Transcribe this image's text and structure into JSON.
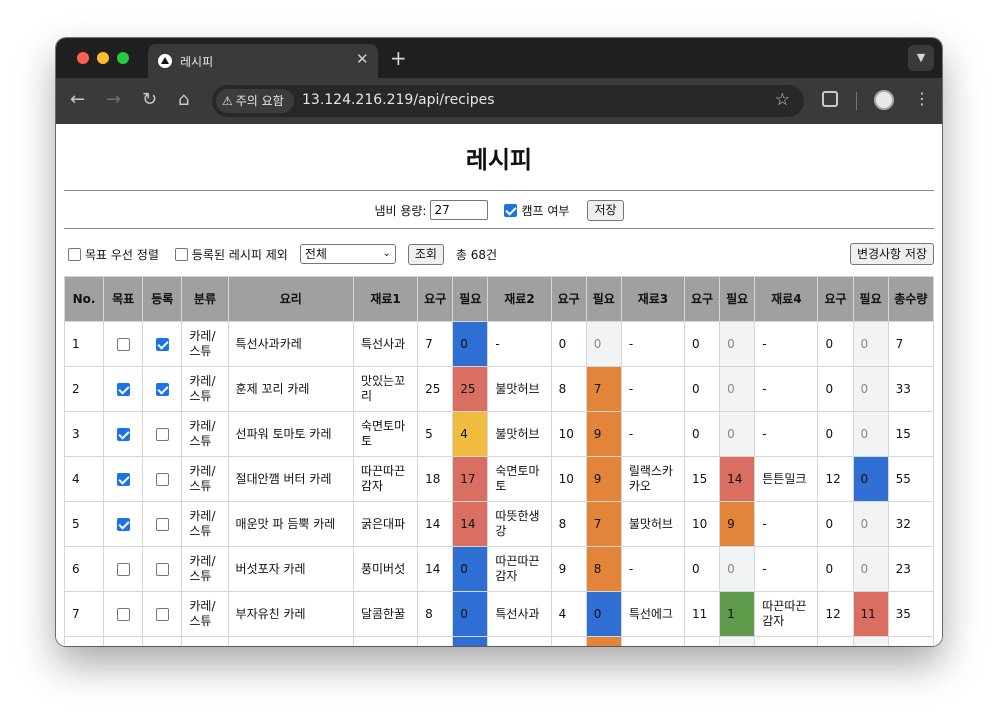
{
  "browser": {
    "tab_title": "레시피",
    "new_tab_label": "+",
    "security_chip": "주의 요함",
    "url": "13.124.216.219/api/recipes"
  },
  "page": {
    "title": "레시피",
    "settings": {
      "pot_label": "냄비 용량:",
      "pot_value": "27",
      "camp_label": "캠프 여부",
      "camp_checked": true,
      "save_label": "저장"
    },
    "filters": {
      "goal_sort_label": "목표 우선 정렬",
      "exclude_registered_label": "등록된 레시피 제외",
      "category_selected": "전체",
      "search_label": "조회",
      "total_count": "총 68건",
      "save_changes_label": "변경사항 저장"
    },
    "table": {
      "headers": [
        "No.",
        "목표",
        "등록",
        "분류",
        "요리",
        "재료1",
        "요구",
        "필요",
        "재료2",
        "요구",
        "필요",
        "재료3",
        "요구",
        "필요",
        "재료4",
        "요구",
        "필요",
        "총수량"
      ],
      "rows": [
        {
          "no": "1",
          "goal": false,
          "reg": true,
          "cat": "카레/스튜",
          "dish": "특선사과카레",
          "i1": "특선사과",
          "r1": "7",
          "n1": "0",
          "l1": "blue",
          "i2": "-",
          "r2": "0",
          "n2": "0",
          "l2": "none",
          "i3": "-",
          "r3": "0",
          "n3": "0",
          "l3": "none",
          "i4": "-",
          "r4": "0",
          "n4": "0",
          "l4": "none",
          "total": "7"
        },
        {
          "no": "2",
          "goal": true,
          "reg": true,
          "cat": "카레/스튜",
          "dish": "훈제 꼬리 카레",
          "i1": "맛있는꼬리",
          "r1": "25",
          "n1": "25",
          "l1": "red",
          "i2": "불맛허브",
          "r2": "8",
          "n2": "7",
          "l2": "orange",
          "i3": "-",
          "r3": "0",
          "n3": "0",
          "l3": "none",
          "i4": "-",
          "r4": "0",
          "n4": "0",
          "l4": "none",
          "total": "33"
        },
        {
          "no": "3",
          "goal": true,
          "reg": false,
          "cat": "카레/스튜",
          "dish": "선파워 토마토 카레",
          "i1": "숙면토마토",
          "r1": "5",
          "n1": "4",
          "l1": "yellow",
          "i2": "불맛허브",
          "r2": "10",
          "n2": "9",
          "l2": "orange",
          "i3": "-",
          "r3": "0",
          "n3": "0",
          "l3": "none",
          "i4": "-",
          "r4": "0",
          "n4": "0",
          "l4": "none",
          "total": "15"
        },
        {
          "no": "4",
          "goal": true,
          "reg": false,
          "cat": "카레/스튜",
          "dish": "절대안깸 버터 카레",
          "i1": "따끈따끈감자",
          "r1": "18",
          "n1": "17",
          "l1": "red",
          "i2": "숙면토마토",
          "r2": "10",
          "n2": "9",
          "l2": "orange",
          "i3": "릴랙스카카오",
          "r3": "15",
          "n3": "14",
          "l3": "red",
          "i4": "튼튼밀크",
          "r4": "12",
          "n4": "0",
          "l4": "blue",
          "total": "55"
        },
        {
          "no": "5",
          "goal": true,
          "reg": false,
          "cat": "카레/스튜",
          "dish": "매운맛 파 듬뿍 카레",
          "i1": "굵은대파",
          "r1": "14",
          "n1": "14",
          "l1": "red",
          "i2": "따뜻한생강",
          "r2": "8",
          "n2": "7",
          "l2": "orange",
          "i3": "불맛허브",
          "r3": "10",
          "n3": "9",
          "l3": "orange",
          "i4": "-",
          "r4": "0",
          "n4": "0",
          "l4": "none",
          "total": "32"
        },
        {
          "no": "6",
          "goal": false,
          "reg": false,
          "cat": "카레/스튜",
          "dish": "버섯포자 카레",
          "i1": "풍미버섯",
          "r1": "14",
          "n1": "0",
          "l1": "blue",
          "i2": "따끈따끈감자",
          "r2": "9",
          "n2": "8",
          "l2": "orange",
          "i3": "-",
          "r3": "0",
          "n3": "0",
          "l3": "none",
          "i4": "-",
          "r4": "0",
          "n4": "0",
          "l4": "none",
          "total": "23"
        },
        {
          "no": "7",
          "goal": false,
          "reg": false,
          "cat": "카레/스튜",
          "dish": "부자유친 카레",
          "i1": "달콤한꿀",
          "r1": "8",
          "n1": "0",
          "l1": "blue",
          "i2": "특선사과",
          "r2": "4",
          "n2": "0",
          "l2": "blue",
          "i3": "특선에그",
          "r3": "11",
          "n3": "1",
          "l3": "green",
          "i4": "따끈따끈감자",
          "r4": "12",
          "n4": "11",
          "l4": "red",
          "total": "35"
        },
        {
          "no": "",
          "goal": false,
          "reg": false,
          "cat": "",
          "dish": "",
          "i1": "",
          "r1": "",
          "n1": "",
          "l1": "blue",
          "i2": "",
          "r2": "",
          "n2": "",
          "l2": "orange",
          "i3": "",
          "r3": "",
          "n3": "",
          "l3": "none",
          "i4": "",
          "r4": "",
          "n4": "",
          "l4": "none",
          "total": ""
        }
      ]
    }
  },
  "colors": {
    "header_bg": "#a0a0a0",
    "level_blue": "#2f6fd3",
    "level_red": "#da6e60",
    "level_yellow": "#f0bc3f",
    "level_orange": "#e2843a",
    "level_green": "#5e9a4a",
    "level_none": "#f1f3f4"
  }
}
